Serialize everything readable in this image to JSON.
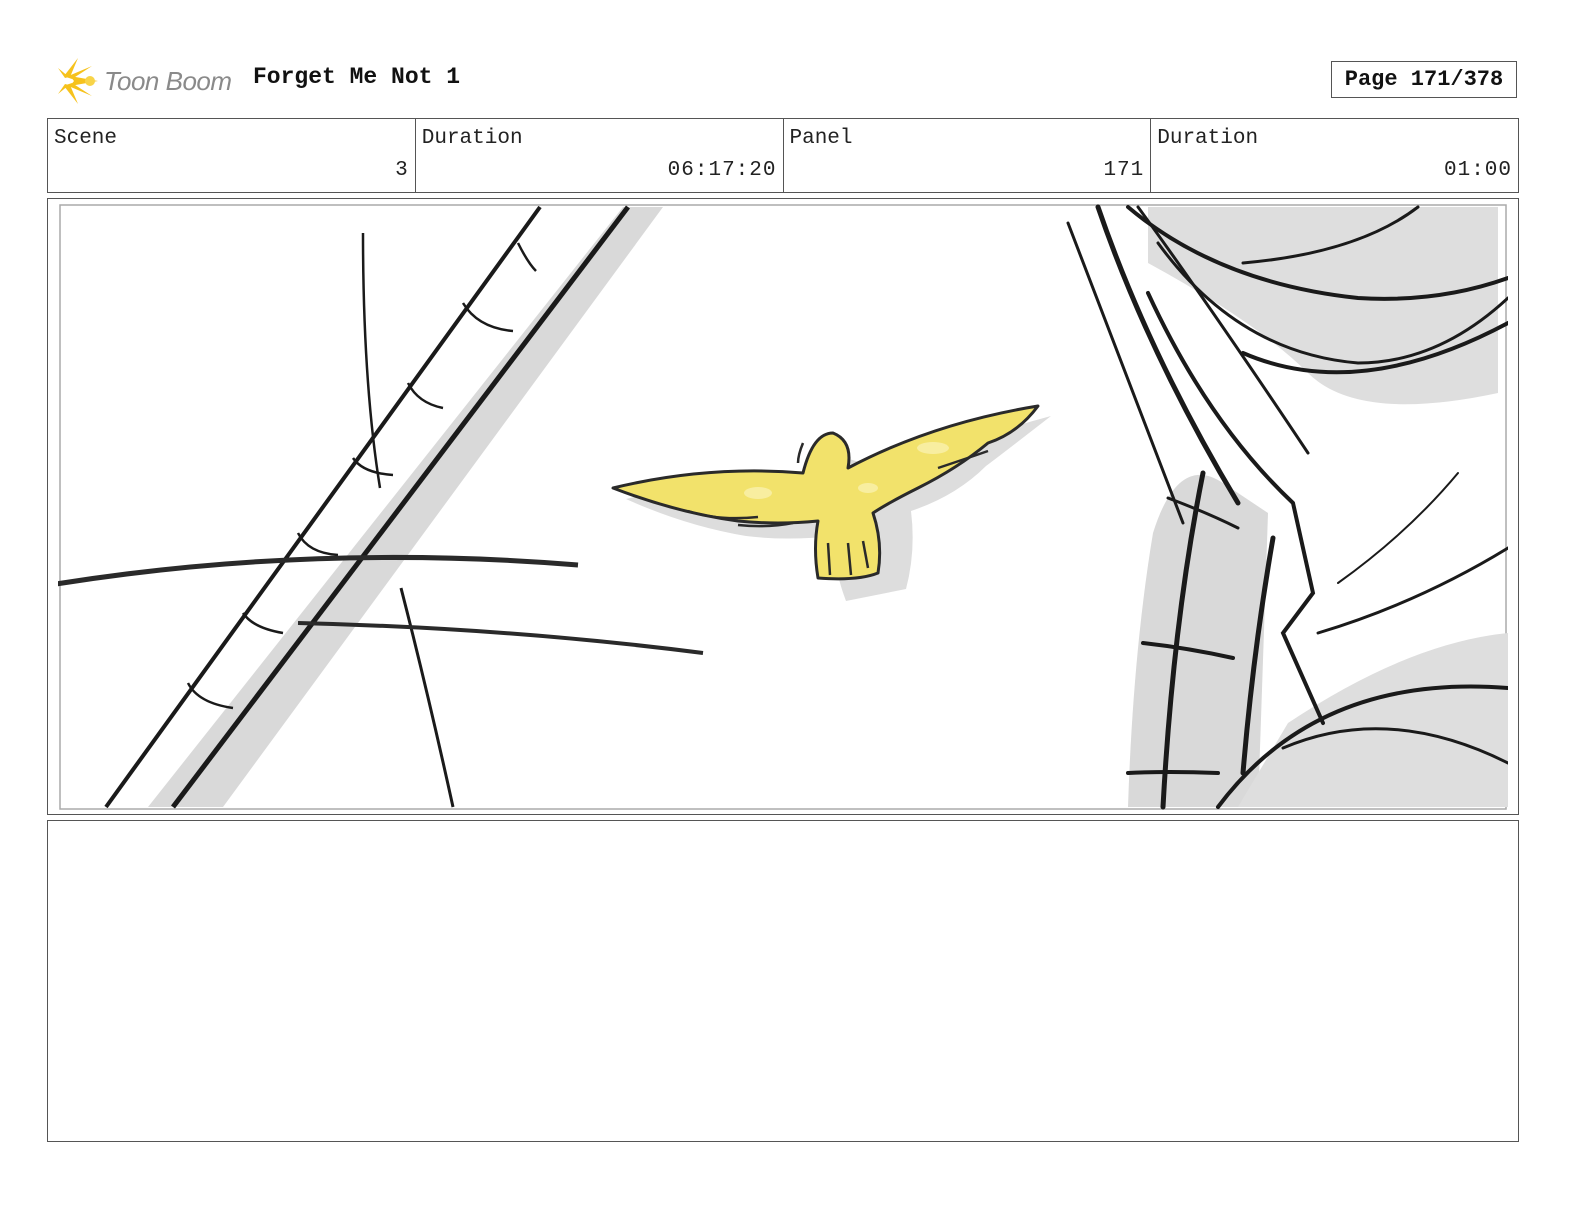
{
  "header": {
    "logo_text": "Toon Boom",
    "project_title": "Forget Me Not 1",
    "page_label": "Page 171/378"
  },
  "info": {
    "scene_label": "Scene",
    "scene_value": "3",
    "scene_duration_label": "Duration",
    "scene_duration_value": "06:17:20",
    "panel_label": "Panel",
    "panel_value": "171",
    "panel_duration_label": "Duration",
    "panel_duration_value": "01:00"
  },
  "panel": {
    "bird_color": "#f2e26b",
    "shadow_color": "#d9d9d9",
    "line_color": "#1a1a1a"
  },
  "notes": {
    "text": ""
  }
}
